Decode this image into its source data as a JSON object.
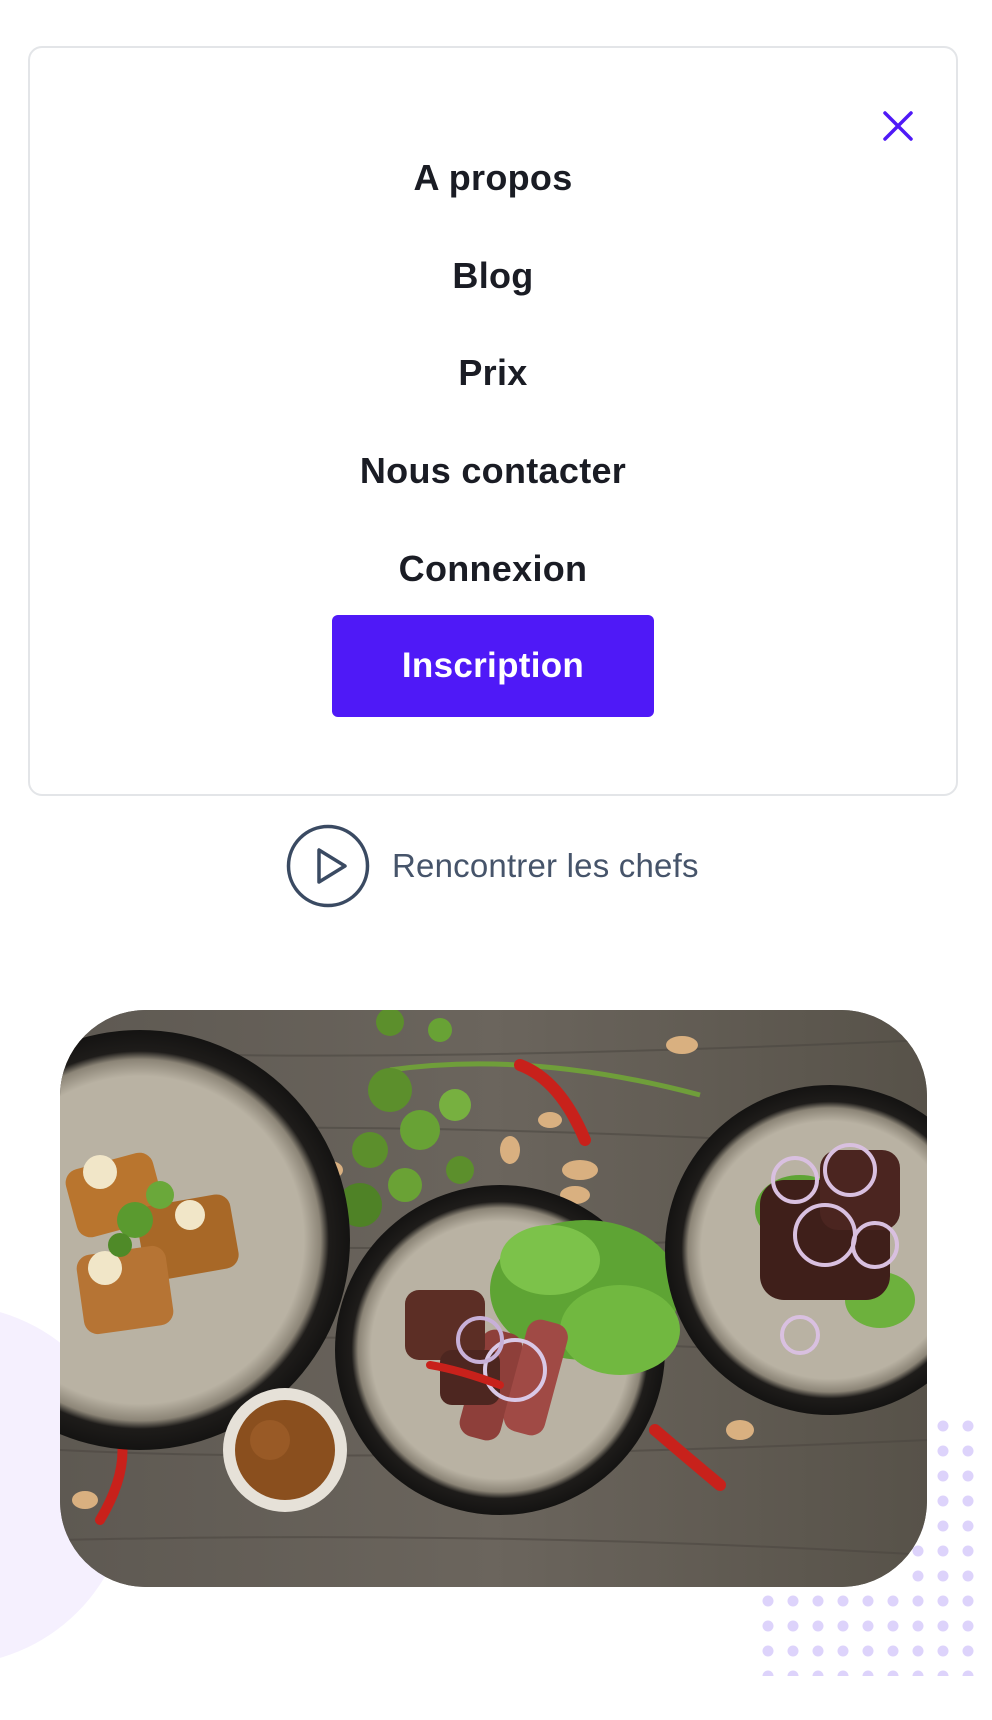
{
  "menu": {
    "items": [
      {
        "label": "A propos"
      },
      {
        "label": "Blog"
      },
      {
        "label": "Prix"
      },
      {
        "label": "Nous contacter"
      },
      {
        "label": "Connexion"
      }
    ],
    "signup_label": "Inscription",
    "close_icon": "close-icon"
  },
  "hero": {
    "chefs_link_label": "Rencontrer les chefs",
    "chefs_link_icon": "play-circle-icon",
    "image_alt": "Plats de viande et salade sur une table en bois"
  },
  "colors": {
    "accent": "#4f19f7",
    "text_dark": "#1a1c24",
    "text_muted": "#46546a",
    "decor_light": "#f5f0fe",
    "decor_dots": "#ddd3fb"
  }
}
